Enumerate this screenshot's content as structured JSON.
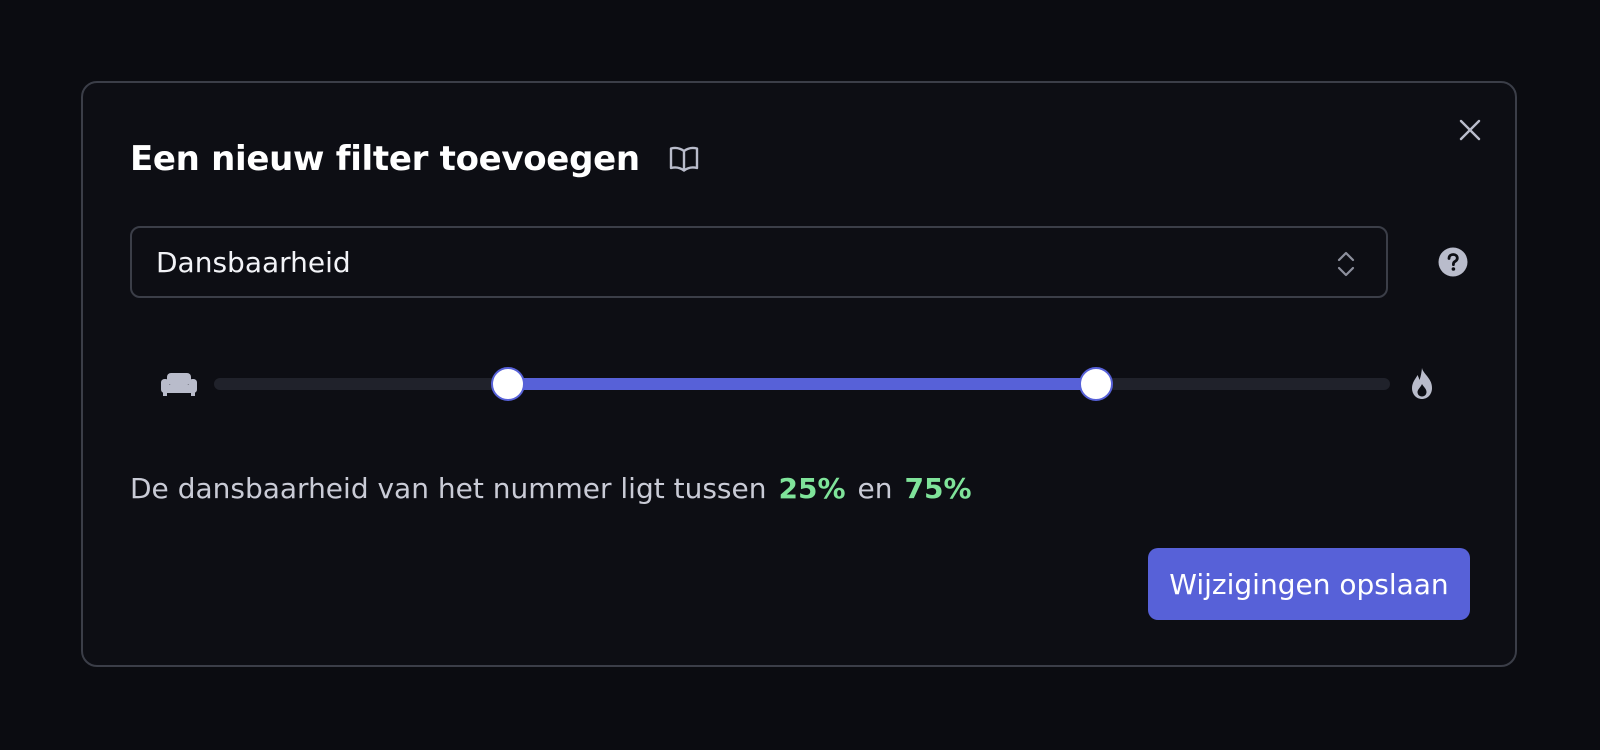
{
  "dialog": {
    "title": "Een nieuw filter toevoegen",
    "close_icon": "close-icon",
    "guide_icon": "book-open-icon"
  },
  "filter_select": {
    "value": "Dansbaarheid",
    "icon": "chevron-up-down-icon"
  },
  "help": {
    "icon": "question-circle-icon"
  },
  "range_slider": {
    "min": 0,
    "max": 100,
    "lower": 25,
    "upper": 75,
    "min_icon": "couch-icon",
    "max_icon": "fire-icon"
  },
  "description": {
    "prefix": "De dansbaarheid van het nummer ligt tussen",
    "lower_value": "25%",
    "connector": "en",
    "upper_value": "75%"
  },
  "actions": {
    "save_label": "Wijzigingen opslaan"
  },
  "colors": {
    "background": "#0b0c11",
    "panel": "#0d0e14",
    "border": "#3b3e48",
    "accent": "#5761d8",
    "highlight": "#7fe39a",
    "muted_text": "#c9cbd6",
    "icon": "#b9bccb"
  }
}
